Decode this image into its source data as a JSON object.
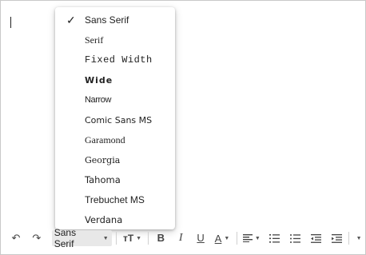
{
  "editor": {
    "body_text": ""
  },
  "font_menu": {
    "selected": "Sans Serif",
    "items": [
      {
        "label": "Sans Serif",
        "checked": true
      },
      {
        "label": "Serif"
      },
      {
        "label": "Fixed Width"
      },
      {
        "label": "Wide"
      },
      {
        "label": "Narrow"
      },
      {
        "label": "Comic Sans MS"
      },
      {
        "label": "Garamond"
      },
      {
        "label": "Georgia"
      },
      {
        "label": "Tahoma"
      },
      {
        "label": "Trebuchet MS"
      },
      {
        "label": "Verdana"
      }
    ],
    "check_glyph": "✓"
  },
  "toolbar": {
    "undo_icon": "↶",
    "redo_icon": "↷",
    "font_value": "Sans Serif",
    "dropdown_glyph": "▼",
    "size_icon": "тT",
    "bold": "B",
    "italic": "I",
    "underline": "U",
    "text_color": "A",
    "icons": [
      "undo-icon",
      "redo-icon",
      "font-size-icon",
      "bold-icon",
      "italic-icon",
      "underline-icon",
      "text-color-icon",
      "align-icon",
      "numbered-list-icon",
      "bulleted-list-icon",
      "indent-less-icon",
      "indent-more-icon",
      "more-options-icon"
    ]
  },
  "colors": {
    "menu_bg": "#ffffff",
    "select_bg": "#e8e8e8",
    "icon": "#444444"
  }
}
